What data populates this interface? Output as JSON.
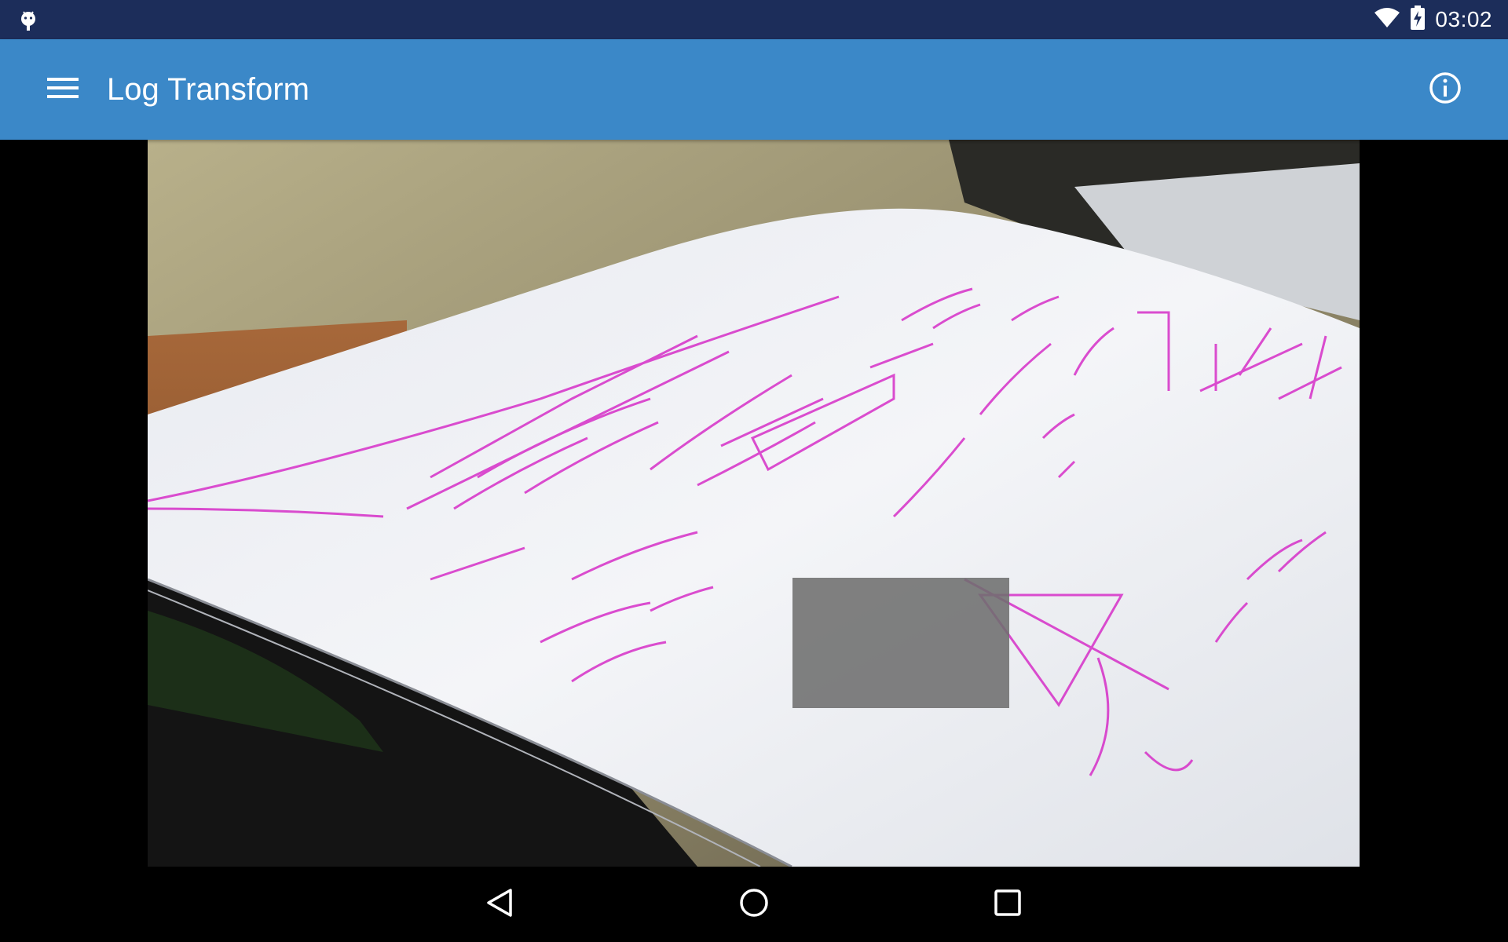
{
  "status_bar": {
    "notification_icon": "android-debug-icon",
    "wifi_icon": "wifi-icon",
    "battery_icon": "battery-charging-icon",
    "time": "03:02"
  },
  "app_bar": {
    "menu_icon": "hamburger-menu-icon",
    "title": "Log Transform",
    "info_icon": "info-icon",
    "background_color": "#3b88c8"
  },
  "content": {
    "preview_description_visible": false
  },
  "nav_bar": {
    "back_icon": "back-triangle-icon",
    "home_icon": "home-circle-icon",
    "recents_icon": "recents-square-icon"
  },
  "colors": {
    "status_bar": "#1c2d5a",
    "app_bar": "#3b88c8",
    "roi_box": "#6e6e6e",
    "ink": "#d62fc8"
  }
}
